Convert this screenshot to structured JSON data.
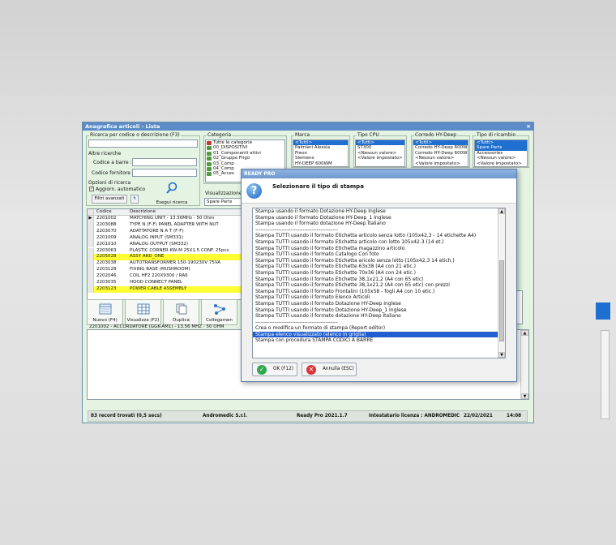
{
  "window": {
    "title": "Anagrafica articoli - Lista",
    "close_glyph": "×"
  },
  "search": {
    "group_label": "Ricerca per codice o descrizione (F3)",
    "other_label": "Altre ricerche",
    "barcode_label": "Codice a barre :",
    "supplier_label": "Codice fornitore :",
    "options_label": "Opzioni di ricerca",
    "auto_update_label": "Aggiorn. automatico",
    "advanced_filters_label": "Filtri avanzati",
    "run_search_label": "Esegui ricerca"
  },
  "category": {
    "label": "Categoria",
    "items": [
      "Tutte le categorie",
      "00_DISPOSITIVI",
      "01_Componenti attivi",
      "02_Gruppo Frigo",
      "03_Comp",
      "04_Comp",
      "05_Acces"
    ]
  },
  "visualization": {
    "label": "Visualizzazione",
    "value": "Spare Parts"
  },
  "brand": {
    "label": "Marca",
    "items": [
      "<Tutti>",
      "Palmieri Alessia",
      "Freon",
      "Siemens",
      "HY-DEEP 600WM"
    ]
  },
  "cpu": {
    "label": "Tipo CPU",
    "items": [
      "<Tutti>",
      "ST300",
      "<Nessun valore>",
      "<Valore impostato>"
    ]
  },
  "corredo": {
    "label": "Corredo HY-Deep",
    "items": [
      "<Tutti>",
      "Corredo HY-Deep 600WM",
      "Corredo HY-Deep 600WM,",
      "<Nessun valore>",
      "<Valore impostato>"
    ]
  },
  "ricambio": {
    "label": "Tipo di ricambio",
    "items": [
      "<Tutti>",
      "Spare Parts",
      "Accessories",
      "<Nessun valore>",
      "<Valore impostato>"
    ]
  },
  "grid": {
    "headers": {
      "code": "Codice",
      "desc": "Descrizione"
    },
    "rows": [
      {
        "marker": "▶",
        "code": "2201002",
        "desc": "MATCHING UNIT - 13.56MHz - 50 Ohm"
      },
      {
        "marker": "",
        "code": "2203088",
        "desc": "TYPE N (F-F) PANEL ADAPTER WITH NUT"
      },
      {
        "marker": "",
        "code": "2203070",
        "desc": "ADATTATORE N A T (F-F)"
      },
      {
        "marker": "",
        "code": "2201009",
        "desc": "ANALOG INPUT (SM331)"
      },
      {
        "marker": "",
        "code": "2201010",
        "desc": "ANALOG OUTPUT (SM332)"
      },
      {
        "marker": "",
        "code": "2203063",
        "desc": "PLASTIC CORNER KW-M 25X1.5 CONF. 25pcs."
      },
      {
        "marker": "",
        "code": "2205028",
        "desc": "ASSY ARD_ONE"
      },
      {
        "marker": "",
        "code": "2203038",
        "desc": "AUTOTRANSFORMER 150-190230V 75VA"
      },
      {
        "marker": "",
        "code": "2203128",
        "desc": "FIXING BASE (MUSHROOM)"
      },
      {
        "marker": "",
        "code": "2202046",
        "desc": "COIL HF2 220X9300 / RA6"
      },
      {
        "marker": "",
        "code": "2203035",
        "desc": "HOOD CONNECT PANEL"
      },
      {
        "marker": "",
        "code": "2203123",
        "desc": "POWER CABLE ASSEMBLY"
      }
    ],
    "highlight_color": "#ffff33"
  },
  "toolbar": {
    "new": "Nuovo (F4)",
    "view": "Visualizza (F2)",
    "duplicate": "Duplica",
    "links": "Collegamen"
  },
  "note": {
    "title": "2201002 - ACCORDATORE (GGK-AM1) - 13.56 MHZ - 50 OHM"
  },
  "status": {
    "records": "83 record trovati (0,5 secs)",
    "company": "Andromedic S.r.l.",
    "product": "Ready Pro 2021.1.7",
    "licensee": "Intestatario licenza : ANDROMEDIC ITA",
    "date": "22/02/2021",
    "time": "14:08"
  },
  "dialog": {
    "title": "READY PRO",
    "heading": "Selezionare il tipo di stampa",
    "icon_glyph": "?",
    "items": [
      "Stampa usando il formato Dotazione HY-Deep Inglese",
      "Stampa usando il formato Dotazione HY-Deep_1 Inglese",
      "Stampa usando il formato dotazione HY-Deep Italiano",
      "-----------------------------------------------",
      "Stampa TUTTI usando il formato Etichetta articolo senza lotto (105x42,3 - 14 etichette A4)",
      "Stampa TUTTI usando il formato Etichetta articolo con lotto 105x42.3 (14 et.)",
      "Stampa TUTTI usando il formato Etichetta magazzino articolo",
      "Stampa TUTTI usando il formato Catalogo Con foto",
      "Stampa TUTTI usando il formato Etichetta aricolo senza lotto (105x42,3 14 etich.)",
      "Stampa TUTTI usando il formato Etichette 63x38 (A4 con 21 etic.)",
      "Stampa TUTTI usando il formato Etichette 70x36 (A4 con 24 etic.)",
      "Stampa TUTTI usando il formato Etichette 38,1x21,2 (A4 con 65 etic)",
      "Stampa TUTTI usando il formato Etichette 38,1x21,2 (A4 con 65 etic) con prezzi",
      "Stampa TUTTI usando il formato Frontalini (105x58 - fogli A4 con 10 etic.)",
      "Stampa TUTTI usando il formato Elenco Articoli",
      "Stampa TUTTI usando il formato Dotazione HY-Deep Inglese",
      "Stampa TUTTI usando il formato Dotazione HY-Deep_1 Inglese",
      "Stampa TUTTI usando il formato dotazione HY-Deep Italiano",
      "-----------------------------------------------",
      "Crea o modifica un formato di stampa (Report editor)",
      "Stampa elenco visualizzato (elenco in griglia)",
      "Stampa con procedura STAMPA CODICI A BARRE"
    ],
    "selected_index": 20,
    "ok_label": "OK (F12)",
    "cancel_label": "Annulla (ESC)",
    "ok_glyph": "✓",
    "cancel_glyph": "✕",
    "ok_color": "#2fa84f",
    "cancel_color": "#d9343a"
  }
}
